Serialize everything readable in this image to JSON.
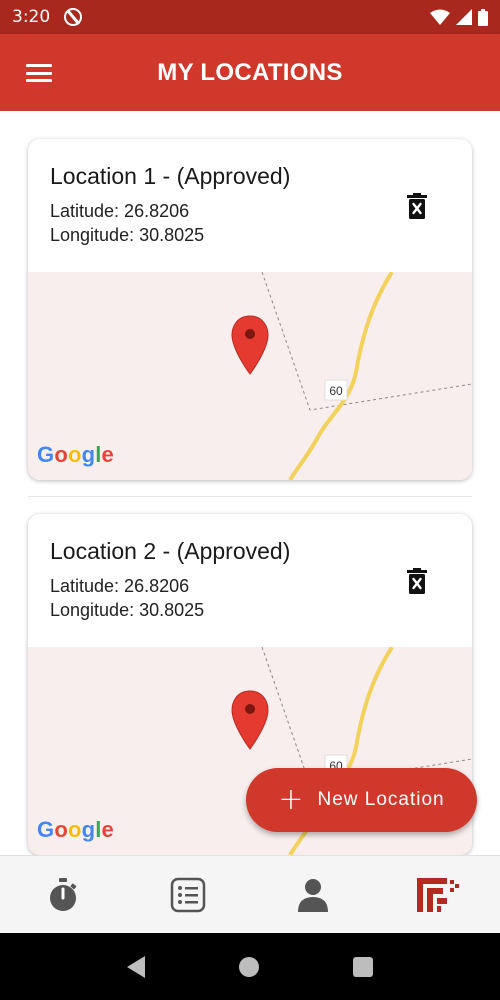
{
  "status": {
    "time": "3:20"
  },
  "appbar": {
    "title": "MY LOCATIONS"
  },
  "locations": [
    {
      "name": "Location 1 - (Approved)",
      "latitude": "Latitude: 26.8206",
      "longitude": "Longitude: 30.8025",
      "road_label": "60"
    },
    {
      "name": "Location 2 - (Approved)",
      "latitude": "Latitude: 26.8206",
      "longitude": "Longitude: 30.8025",
      "road_label": "60"
    }
  ],
  "map": {
    "attribution": "Google"
  },
  "fab": {
    "label": "New Location",
    "icon": "plus-icon"
  },
  "bottom_nav": [
    {
      "icon": "stopwatch-icon",
      "active": false
    },
    {
      "icon": "list-icon",
      "active": false
    },
    {
      "icon": "person-icon",
      "active": false
    },
    {
      "icon": "brand-logo-icon",
      "active": true
    }
  ],
  "colors": {
    "primary": "#d0382b",
    "status_bar": "#a8281d",
    "map_bg": "#f8eeee",
    "road": "#f2d25a"
  }
}
